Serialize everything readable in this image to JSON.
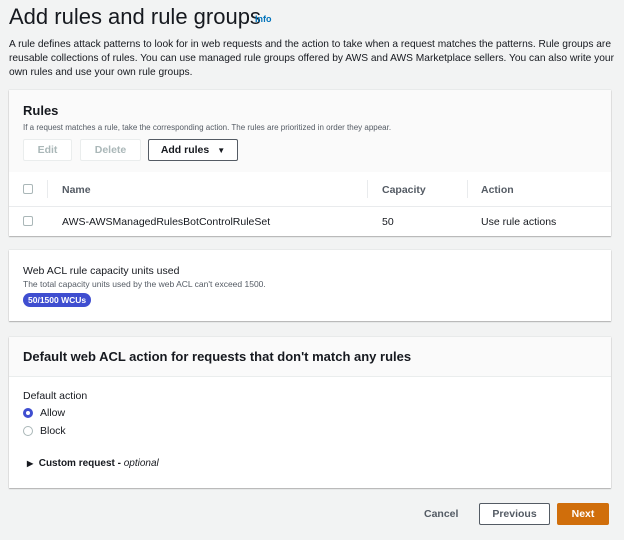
{
  "page": {
    "title": "Add rules and rule groups",
    "info_label": "Info",
    "description": "A rule defines attack patterns to look for in web requests and the action to take when a request matches the patterns. Rule groups are reusable collections of rules. You can use managed rule groups offered by AWS and AWS Marketplace sellers. You can also write your own rules and use your own rule groups."
  },
  "rules": {
    "title": "Rules",
    "description": "If a request matches a rule, take the corresponding action. The rules are prioritized in order they appear.",
    "edit_label": "Edit",
    "delete_label": "Delete",
    "add_rules_label": "Add rules",
    "columns": [
      "Name",
      "Capacity",
      "Action"
    ],
    "rows": [
      {
        "name": "AWS-AWSManagedRulesBotControlRuleSet",
        "capacity": "50",
        "action": "Use rule actions"
      }
    ]
  },
  "capacity": {
    "title": "Web ACL rule capacity units used",
    "description": "The total capacity units used by the web ACL can't exceed 1500.",
    "badge": "50/1500 WCUs",
    "badge_color": "#3f4ed0"
  },
  "default_action": {
    "title": "Default web ACL action for requests that don't match any rules",
    "label": "Default action",
    "options": [
      "Allow",
      "Block"
    ],
    "selected": "Allow",
    "custom_request_label": "Custom request",
    "custom_request_optional": "optional"
  },
  "footer": {
    "cancel_label": "Cancel",
    "previous_label": "Previous",
    "next_label": "Next",
    "next_color": "#d06e0b"
  }
}
